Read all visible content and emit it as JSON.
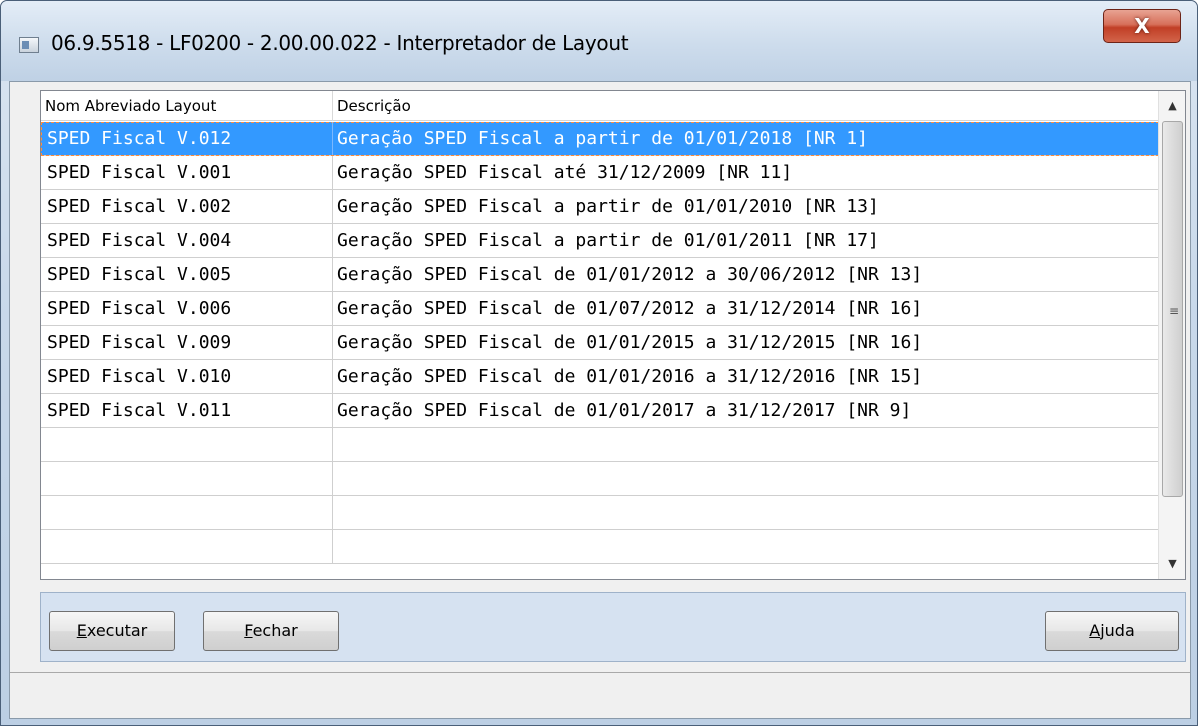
{
  "window": {
    "title": "06.9.5518 - LF0200 - 2.00.00.022 - Interpretador de Layout",
    "close_label": "X"
  },
  "grid": {
    "columns": [
      "Nom Abreviado Layout",
      "Descrição"
    ],
    "rows": [
      {
        "nome": "SPED Fiscal V.012",
        "descricao": "Geração SPED Fiscal a partir de 01/01/2018 [NR 1]",
        "selected": true
      },
      {
        "nome": "SPED Fiscal V.001",
        "descricao": "Geração SPED Fiscal até 31/12/2009 [NR 11]"
      },
      {
        "nome": "SPED Fiscal V.002",
        "descricao": "Geração SPED Fiscal a partir de 01/01/2010 [NR 13]"
      },
      {
        "nome": "SPED Fiscal V.004",
        "descricao": "Geração SPED Fiscal a partir de 01/01/2011 [NR 17]"
      },
      {
        "nome": "SPED Fiscal V.005",
        "descricao": "Geração SPED Fiscal de 01/01/2012 a 30/06/2012 [NR 13]"
      },
      {
        "nome": "SPED Fiscal V.006",
        "descricao": "Geração SPED Fiscal de 01/07/2012 a 31/12/2014 [NR 16]"
      },
      {
        "nome": "SPED Fiscal V.009",
        "descricao": "Geração SPED Fiscal de 01/01/2015 a 31/12/2015 [NR 16]"
      },
      {
        "nome": "SPED Fiscal V.010",
        "descricao": "Geração SPED Fiscal de 01/01/2016 a 31/12/2016 [NR 15]"
      },
      {
        "nome": "SPED Fiscal V.011",
        "descricao": "Geração SPED Fiscal de 01/01/2017 a 31/12/2017 [NR 9]"
      },
      {
        "nome": "",
        "descricao": ""
      },
      {
        "nome": "",
        "descricao": ""
      },
      {
        "nome": "",
        "descricao": ""
      },
      {
        "nome": "",
        "descricao": ""
      }
    ]
  },
  "buttons": {
    "executar": {
      "mnemonic": "E",
      "rest": "xecutar"
    },
    "fechar": {
      "mnemonic": "F",
      "rest": "echar"
    },
    "ajuda": {
      "mnemonic": "A",
      "rest": "juda"
    }
  },
  "scrollbar": {
    "up_glyph": "▲",
    "down_glyph": "▼",
    "grip_glyph": "≡"
  }
}
